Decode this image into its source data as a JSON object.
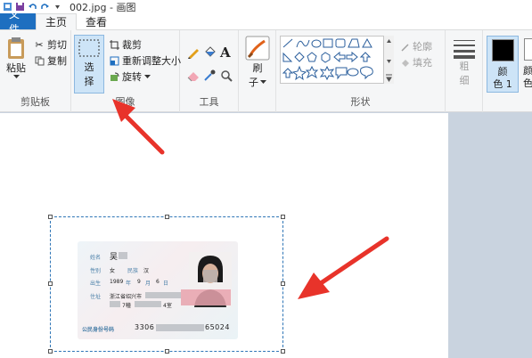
{
  "window": {
    "title": "002.jpg - 画图"
  },
  "tabs": [
    {
      "label": "文件"
    },
    {
      "label": "主页"
    },
    {
      "label": "查看"
    }
  ],
  "ribbon": {
    "clipboard": {
      "label": "剪贴板",
      "paste": "粘贴",
      "cut": "剪切",
      "copy": "复制"
    },
    "image": {
      "label": "图像",
      "select_top": "选",
      "select_bottom": "择",
      "crop": "裁剪",
      "resize": "重新调整大小",
      "rotate": "旋转"
    },
    "tools": {
      "label": "工具"
    },
    "brushes": {
      "label_top": "刷",
      "label_bottom": "子"
    },
    "shapes": {
      "label": "形状",
      "outline": "轮廓",
      "fill": "填充"
    },
    "size": {
      "label_top": "粗",
      "label_bottom": "细"
    },
    "color1": {
      "label_top": "颜",
      "label_bottom": "色 1"
    },
    "color2": {
      "label_top": "颜",
      "label_bottom": "色"
    }
  },
  "id_card": {
    "name_label": "姓名",
    "name_value": "吴",
    "gender_label": "性别",
    "gender_value": "女",
    "ethnicity_label": "民族",
    "ethnicity_value": "汉",
    "birth_label": "出生",
    "birth_year": "1989",
    "birth_year_unit": "年",
    "birth_month": "9",
    "birth_month_unit": "月",
    "birth_day": "6",
    "birth_day_unit": "日",
    "address_label": "住址",
    "address_line1": "浙江省绍兴市",
    "address_line2_a": "7幢",
    "address_line2_b": "4室",
    "id_label": "公民身份号码",
    "id_prefix": "3306",
    "id_suffix": "65024"
  },
  "colors": {
    "accent": "#1e6fc0",
    "arrow": "#e8332a",
    "selection": "#2e75b6"
  }
}
